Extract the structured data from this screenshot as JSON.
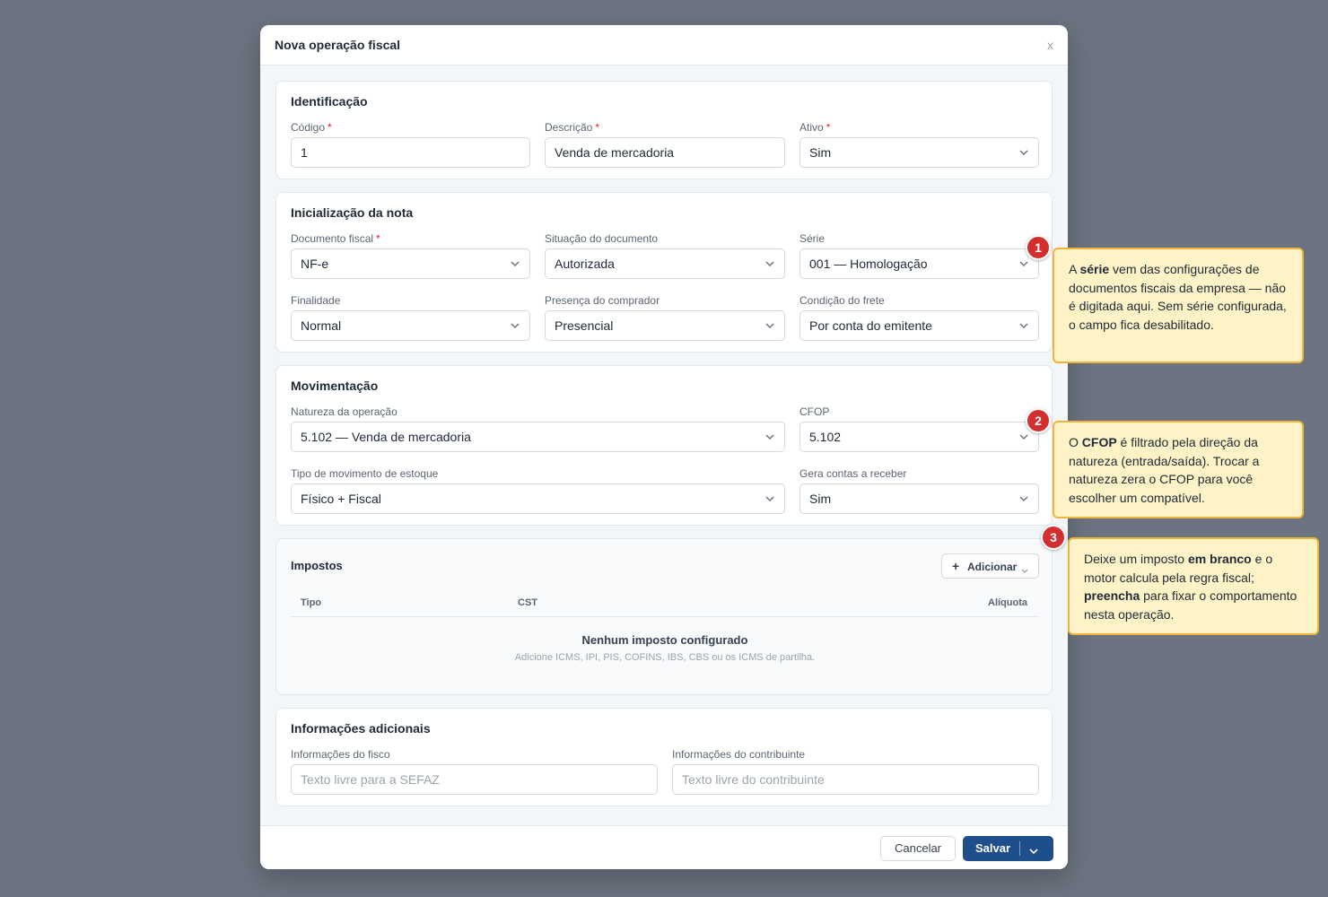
{
  "modal": {
    "title": "Nova operação fiscal",
    "close_label": "x"
  },
  "identificacao": {
    "title": "Identificação",
    "codigo": {
      "label": "Código",
      "value": "1"
    },
    "descricao": {
      "label": "Descrição",
      "value": "Venda de mercadoria"
    },
    "ativo": {
      "label": "Ativo",
      "value": "Sim"
    }
  },
  "inicializacao": {
    "title": "Inicialização da nota",
    "documento_fiscal": {
      "label": "Documento fiscal",
      "value": "NF-e"
    },
    "situacao": {
      "label": "Situação do documento",
      "value": "Autorizada"
    },
    "serie": {
      "label": "Série",
      "value": "001 — Homologação"
    },
    "finalidade": {
      "label": "Finalidade",
      "value": "Normal"
    },
    "presenca": {
      "label": "Presença do comprador",
      "value": "Presencial"
    },
    "frete": {
      "label": "Condição do frete",
      "value": "Por conta do emitente"
    }
  },
  "movimentacao": {
    "title": "Movimentação",
    "natureza": {
      "label": "Natureza da operação",
      "value": "5.102 — Venda de mercadoria"
    },
    "cfop": {
      "label": "CFOP",
      "value": "5.102"
    },
    "tipo_movimento": {
      "label": "Tipo de movimento de estoque",
      "value": "Físico + Fiscal"
    },
    "gera_contas": {
      "label": "Gera contas a receber",
      "value": "Sim"
    }
  },
  "impostos": {
    "title": "Impostos",
    "add_label": "Adicionar",
    "columns": {
      "tipo": "Tipo",
      "cst": "CST",
      "aliquota": "Alíquota"
    },
    "empty_title": "Nenhum imposto configurado",
    "empty_subtitle": "Adicione ICMS, IPI, PIS, COFINS, IBS, CBS ou os ICMS de partilha."
  },
  "informacoes": {
    "title": "Informações adicionais",
    "fisco": {
      "label": "Informações do fisco",
      "placeholder": "Texto livre para a SEFAZ"
    },
    "contribuinte": {
      "label": "Informações do contribuinte",
      "placeholder": "Texto livre do contribuinte"
    }
  },
  "footer": {
    "cancel_label": "Cancelar",
    "save_label": "Salvar"
  },
  "required_mark": "*",
  "annotations": [
    {
      "number": "1",
      "parts": [
        "A ",
        "série",
        " vem das configurações de documentos fiscais da empresa — não é digitada aqui. Sem série configurada, o campo fica desabilitado."
      ]
    },
    {
      "number": "2",
      "parts": [
        "O ",
        "CFOP",
        " é filtrado pela direção da natureza (entrada/saída). Trocar a natureza zera o CFOP para você escolher um compatível."
      ]
    },
    {
      "number": "3",
      "parts": [
        "Deixe um imposto ",
        "em branco",
        " e o motor calcula pela regra fiscal; ",
        "preencha",
        " para fixar o comportamento nesta operação."
      ]
    }
  ],
  "colors": {
    "backdrop": "#6b7480",
    "primary": "#1f4e8c",
    "required": "#dc2626",
    "marker": "#d32f2f",
    "callout_bg": "#fef3c7",
    "callout_border": "#f0b43c"
  }
}
